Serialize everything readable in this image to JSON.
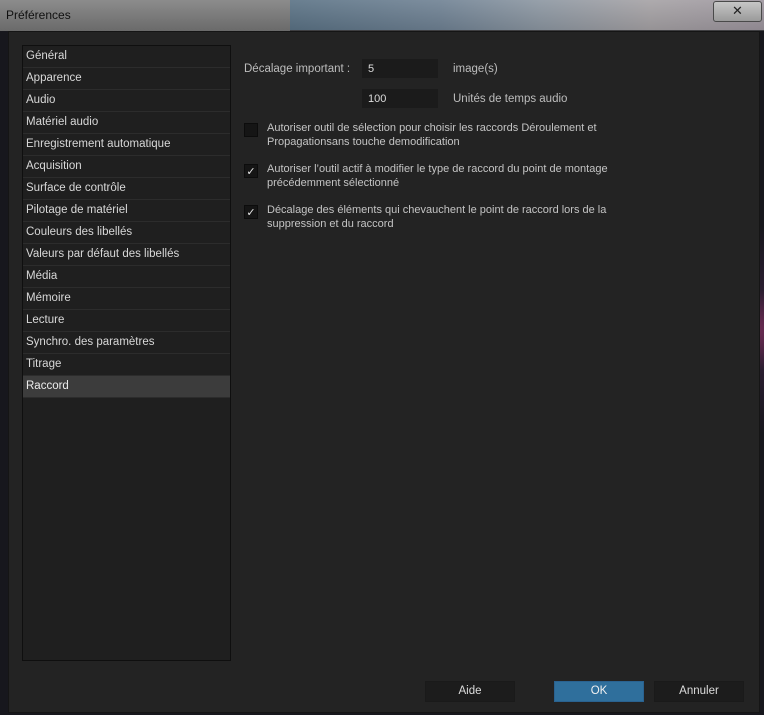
{
  "window": {
    "title": "Préférences",
    "close_symbol": "✕"
  },
  "sidebar": {
    "items": [
      {
        "label": "Général"
      },
      {
        "label": "Apparence"
      },
      {
        "label": "Audio"
      },
      {
        "label": "Matériel audio"
      },
      {
        "label": "Enregistrement automatique"
      },
      {
        "label": "Acquisition"
      },
      {
        "label": "Surface de contrôle"
      },
      {
        "label": "Pilotage de matériel"
      },
      {
        "label": "Couleurs des libellés"
      },
      {
        "label": "Valeurs par défaut des libellés"
      },
      {
        "label": "Média"
      },
      {
        "label": "Mémoire"
      },
      {
        "label": "Lecture"
      },
      {
        "label": "Synchro. des paramètres"
      },
      {
        "label": "Titrage"
      },
      {
        "label": "Raccord"
      }
    ],
    "selected": "Raccord"
  },
  "content": {
    "large_trim_label": "Décalage important :",
    "frames_value": "5",
    "frames_unit": "image(s)",
    "audio_value": "100",
    "audio_unit": "Unités de temps audio",
    "options": [
      {
        "label": "Autoriser outil de sélection pour choisir les raccords Déroulement et Propagationsans touche demodification",
        "checked": false
      },
      {
        "label": "Autoriser l’outil actif à modifier le type de raccord du point de montage précédemment sélectionné",
        "checked": true
      },
      {
        "label": "Décalage des éléments qui chevauchent le point de raccord lors de la suppression et du raccord",
        "checked": true
      }
    ],
    "check_mark": "✓"
  },
  "buttons": {
    "help": "Aide",
    "ok": "OK",
    "cancel": "Annuler"
  },
  "colors": {
    "panel": "#232323",
    "selection": "#3c3c3c",
    "primary_button": "#2f6f9c"
  }
}
